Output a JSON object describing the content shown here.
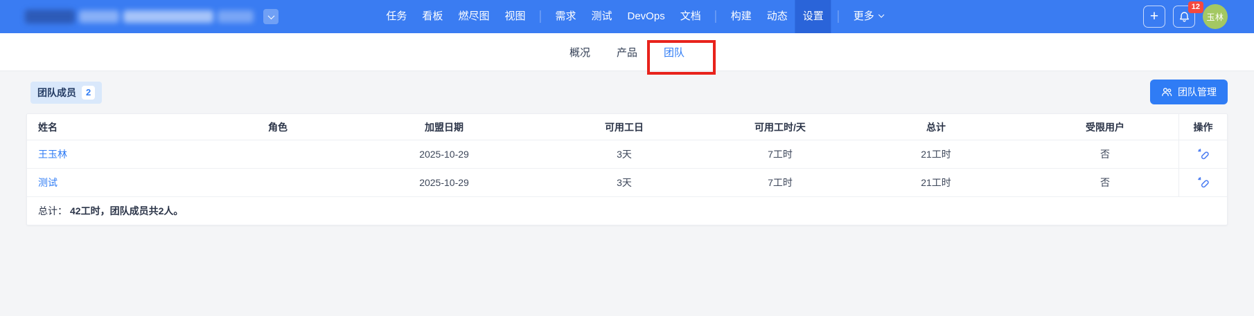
{
  "colors": {
    "topbar_blue": "#3a7cf2",
    "active_nav_blue": "#2a64d9",
    "accent_blue": "#2f7cf5",
    "annotation_red": "#e8231c",
    "notification_red": "#f5483e",
    "avatar_green": "#a4c862",
    "badge_bg": "#d9e8fb"
  },
  "topbar": {
    "nav": [
      "任务",
      "看板",
      "燃尽图",
      "视图",
      "需求",
      "测试",
      "DevOps",
      "文档",
      "构建",
      "动态",
      "设置",
      "更多"
    ],
    "active_item": "设置",
    "icons": {
      "plus": "+",
      "bell": "bell-icon",
      "project_dropdown": "chevron-down-icon",
      "more_dropdown": "chevron-down-icon"
    },
    "notification_count": "12",
    "avatar_text": "玉林"
  },
  "tabs": {
    "items": [
      {
        "label": "概况",
        "active": false
      },
      {
        "label": "产品",
        "active": false
      },
      {
        "label": "团队",
        "active": true,
        "annotated": true
      }
    ]
  },
  "toolbar": {
    "members_badge": {
      "label": "团队成员",
      "count": "2"
    },
    "manage_button": {
      "label": "团队管理",
      "icon": "team-users-icon"
    }
  },
  "table": {
    "headers": [
      "姓名",
      "角色",
      "加盟日期",
      "可用工日",
      "可用工时/天",
      "总计",
      "受限用户",
      "操作"
    ],
    "rows": [
      {
        "name": "王玉林",
        "role": "",
        "join_date": "2025-10-29",
        "workdays": "3天",
        "hours_per_day": "7工时",
        "total": "21工时",
        "restricted": "否",
        "action_icon": "unlink-icon"
      },
      {
        "name": "测试",
        "role": "",
        "join_date": "2025-10-29",
        "workdays": "3天",
        "hours_per_day": "7工时",
        "total": "21工时",
        "restricted": "否",
        "action_icon": "unlink-icon"
      }
    ],
    "summary": {
      "label": "总计：",
      "text": "42工时，团队成员共2人。"
    }
  }
}
